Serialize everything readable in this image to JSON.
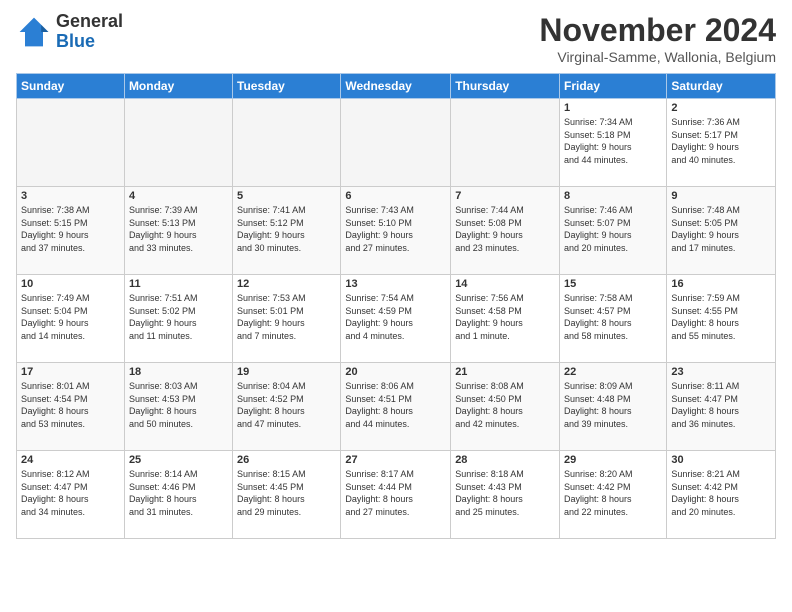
{
  "header": {
    "logo_line1": "General",
    "logo_line2": "Blue",
    "title": "November 2024",
    "subtitle": "Virginal-Samme, Wallonia, Belgium"
  },
  "weekdays": [
    "Sunday",
    "Monday",
    "Tuesday",
    "Wednesday",
    "Thursday",
    "Friday",
    "Saturday"
  ],
  "weeks": [
    [
      {
        "day": "",
        "info": ""
      },
      {
        "day": "",
        "info": ""
      },
      {
        "day": "",
        "info": ""
      },
      {
        "day": "",
        "info": ""
      },
      {
        "day": "",
        "info": ""
      },
      {
        "day": "1",
        "info": "Sunrise: 7:34 AM\nSunset: 5:18 PM\nDaylight: 9 hours\nand 44 minutes."
      },
      {
        "day": "2",
        "info": "Sunrise: 7:36 AM\nSunset: 5:17 PM\nDaylight: 9 hours\nand 40 minutes."
      }
    ],
    [
      {
        "day": "3",
        "info": "Sunrise: 7:38 AM\nSunset: 5:15 PM\nDaylight: 9 hours\nand 37 minutes."
      },
      {
        "day": "4",
        "info": "Sunrise: 7:39 AM\nSunset: 5:13 PM\nDaylight: 9 hours\nand 33 minutes."
      },
      {
        "day": "5",
        "info": "Sunrise: 7:41 AM\nSunset: 5:12 PM\nDaylight: 9 hours\nand 30 minutes."
      },
      {
        "day": "6",
        "info": "Sunrise: 7:43 AM\nSunset: 5:10 PM\nDaylight: 9 hours\nand 27 minutes."
      },
      {
        "day": "7",
        "info": "Sunrise: 7:44 AM\nSunset: 5:08 PM\nDaylight: 9 hours\nand 23 minutes."
      },
      {
        "day": "8",
        "info": "Sunrise: 7:46 AM\nSunset: 5:07 PM\nDaylight: 9 hours\nand 20 minutes."
      },
      {
        "day": "9",
        "info": "Sunrise: 7:48 AM\nSunset: 5:05 PM\nDaylight: 9 hours\nand 17 minutes."
      }
    ],
    [
      {
        "day": "10",
        "info": "Sunrise: 7:49 AM\nSunset: 5:04 PM\nDaylight: 9 hours\nand 14 minutes."
      },
      {
        "day": "11",
        "info": "Sunrise: 7:51 AM\nSunset: 5:02 PM\nDaylight: 9 hours\nand 11 minutes."
      },
      {
        "day": "12",
        "info": "Sunrise: 7:53 AM\nSunset: 5:01 PM\nDaylight: 9 hours\nand 7 minutes."
      },
      {
        "day": "13",
        "info": "Sunrise: 7:54 AM\nSunset: 4:59 PM\nDaylight: 9 hours\nand 4 minutes."
      },
      {
        "day": "14",
        "info": "Sunrise: 7:56 AM\nSunset: 4:58 PM\nDaylight: 9 hours\nand 1 minute."
      },
      {
        "day": "15",
        "info": "Sunrise: 7:58 AM\nSunset: 4:57 PM\nDaylight: 8 hours\nand 58 minutes."
      },
      {
        "day": "16",
        "info": "Sunrise: 7:59 AM\nSunset: 4:55 PM\nDaylight: 8 hours\nand 55 minutes."
      }
    ],
    [
      {
        "day": "17",
        "info": "Sunrise: 8:01 AM\nSunset: 4:54 PM\nDaylight: 8 hours\nand 53 minutes."
      },
      {
        "day": "18",
        "info": "Sunrise: 8:03 AM\nSunset: 4:53 PM\nDaylight: 8 hours\nand 50 minutes."
      },
      {
        "day": "19",
        "info": "Sunrise: 8:04 AM\nSunset: 4:52 PM\nDaylight: 8 hours\nand 47 minutes."
      },
      {
        "day": "20",
        "info": "Sunrise: 8:06 AM\nSunset: 4:51 PM\nDaylight: 8 hours\nand 44 minutes."
      },
      {
        "day": "21",
        "info": "Sunrise: 8:08 AM\nSunset: 4:50 PM\nDaylight: 8 hours\nand 42 minutes."
      },
      {
        "day": "22",
        "info": "Sunrise: 8:09 AM\nSunset: 4:48 PM\nDaylight: 8 hours\nand 39 minutes."
      },
      {
        "day": "23",
        "info": "Sunrise: 8:11 AM\nSunset: 4:47 PM\nDaylight: 8 hours\nand 36 minutes."
      }
    ],
    [
      {
        "day": "24",
        "info": "Sunrise: 8:12 AM\nSunset: 4:47 PM\nDaylight: 8 hours\nand 34 minutes."
      },
      {
        "day": "25",
        "info": "Sunrise: 8:14 AM\nSunset: 4:46 PM\nDaylight: 8 hours\nand 31 minutes."
      },
      {
        "day": "26",
        "info": "Sunrise: 8:15 AM\nSunset: 4:45 PM\nDaylight: 8 hours\nand 29 minutes."
      },
      {
        "day": "27",
        "info": "Sunrise: 8:17 AM\nSunset: 4:44 PM\nDaylight: 8 hours\nand 27 minutes."
      },
      {
        "day": "28",
        "info": "Sunrise: 8:18 AM\nSunset: 4:43 PM\nDaylight: 8 hours\nand 25 minutes."
      },
      {
        "day": "29",
        "info": "Sunrise: 8:20 AM\nSunset: 4:42 PM\nDaylight: 8 hours\nand 22 minutes."
      },
      {
        "day": "30",
        "info": "Sunrise: 8:21 AM\nSunset: 4:42 PM\nDaylight: 8 hours\nand 20 minutes."
      }
    ]
  ]
}
